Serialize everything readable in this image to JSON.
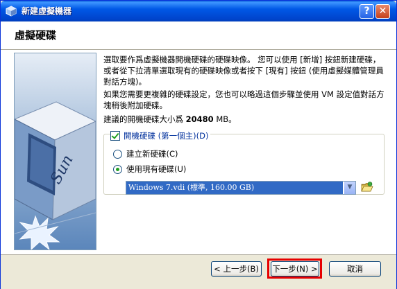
{
  "window": {
    "title": "新建虛擬機器",
    "help_label": "?",
    "close_label": "✕"
  },
  "header": {
    "title": "虛擬硬碟"
  },
  "info": {
    "p1": "選取要作爲虛擬機器開機硬碟的硬碟映像。 您可以使用 [新增] 按鈕新建硬碟，或者從下拉清單選取現有的硬碟映像或者按下 [現有] 按鈕 (使用虛擬媒體管理員對話方塊)。",
    "p2": "如果您需要更複雜的硬碟設定，您也可以略過這個步驟並使用 VM 設定值對話方塊稍後附加硬碟。",
    "p3_prefix": "建議的開機硬碟大小爲 ",
    "p3_size": "20480",
    "p3_suffix": " MB。"
  },
  "boot_disk": {
    "checkbox_label": "開機硬碟 (第一個主)(D)",
    "checked": true,
    "radio_new_label": "建立新硬碟(C)",
    "radio_existing_label": "使用現有硬碟(U)",
    "selected": "existing",
    "disk_value": "Windows 7.vdi (標準, 160.00 GB)"
  },
  "icons": {
    "app": "virtualbox-icon",
    "dropdown": "chevron-down-icon",
    "folder": "folder-open-icon"
  },
  "buttons": {
    "back": "< 上一步(B)",
    "next": "下一步(N) >",
    "cancel": "取消"
  },
  "colors": {
    "titlebar": "#0058e6",
    "selection": "#316ac5",
    "highlight_box": "#e60000",
    "check_green": "#21a121"
  }
}
